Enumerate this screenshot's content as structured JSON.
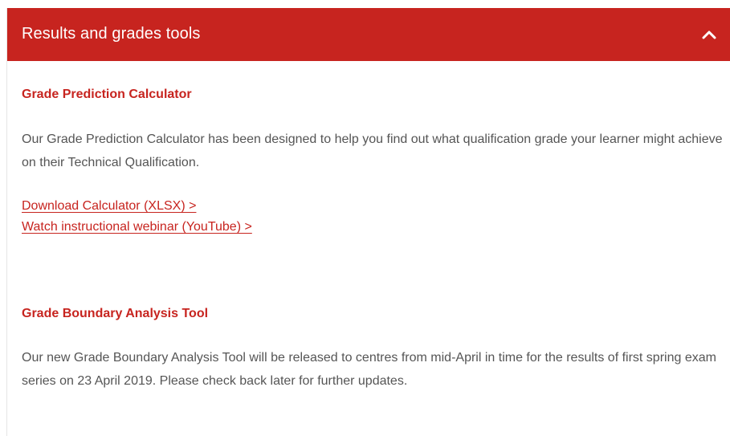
{
  "accordion": {
    "title": "Results and grades tools",
    "toggle_icon": "chevron-up-icon"
  },
  "grade_prediction": {
    "title": "Grade Prediction Calculator",
    "description": "Our Grade Prediction Calculator has been designed to help you find out what qualification grade your learner might achieve on their Technical Qualification.",
    "links": [
      {
        "label": "Download Calculator (XLSX) >"
      },
      {
        "label": "Watch instructional webinar (YouTube) >"
      }
    ]
  },
  "grade_boundary": {
    "title": "Grade Boundary Analysis Tool",
    "description": "Our new Grade Boundary Analysis Tool will be released to centres from mid-April in time for the results of first spring exam series on 23 April 2019. Please check back later for further updates."
  },
  "colors": {
    "accent": "#c7241f",
    "text": "#555555",
    "header_text": "#ffffff"
  }
}
